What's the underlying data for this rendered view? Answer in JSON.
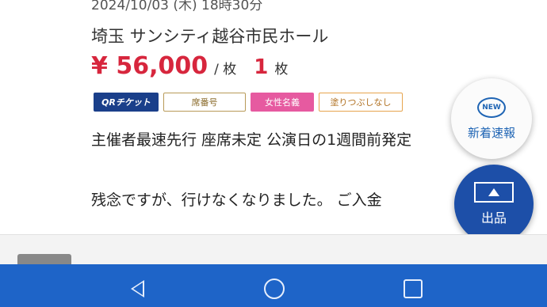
{
  "listing": {
    "datetime": "2024/10/03 (木) 18時30分",
    "venue": "埼玉  サンシティ越谷市民ホール",
    "price": "¥ 56,000",
    "per_unit": "/ 枚",
    "quantity": "1",
    "quantity_unit": "枚",
    "tags": [
      {
        "label": "QRチケット",
        "color": "#1a3f8a"
      },
      {
        "label": "席番号",
        "color": "#b89a58"
      },
      {
        "label": "女性名義",
        "color": "#e65aa0"
      },
      {
        "label": "塗りつぶしなし",
        "color": "#e7a44e"
      }
    ],
    "description": "主催者最速先行 座席未定 公演日の1週間前発定",
    "message": "残念ですが、行けなくなりました。 ご入金"
  },
  "fab": {
    "new_badge": "NEW",
    "new_label": "新着速報",
    "listing_label": "出品"
  },
  "colors": {
    "accent_red": "#d7263d",
    "brand_blue": "#1d4fa8",
    "navbar_blue": "#1e64c8"
  },
  "icons": {
    "nav_back": "back-triangle-icon",
    "nav_home": "home-circle-icon",
    "nav_recent": "recent-apps-square-icon",
    "fab_listing": "ticket-upload-icon"
  }
}
